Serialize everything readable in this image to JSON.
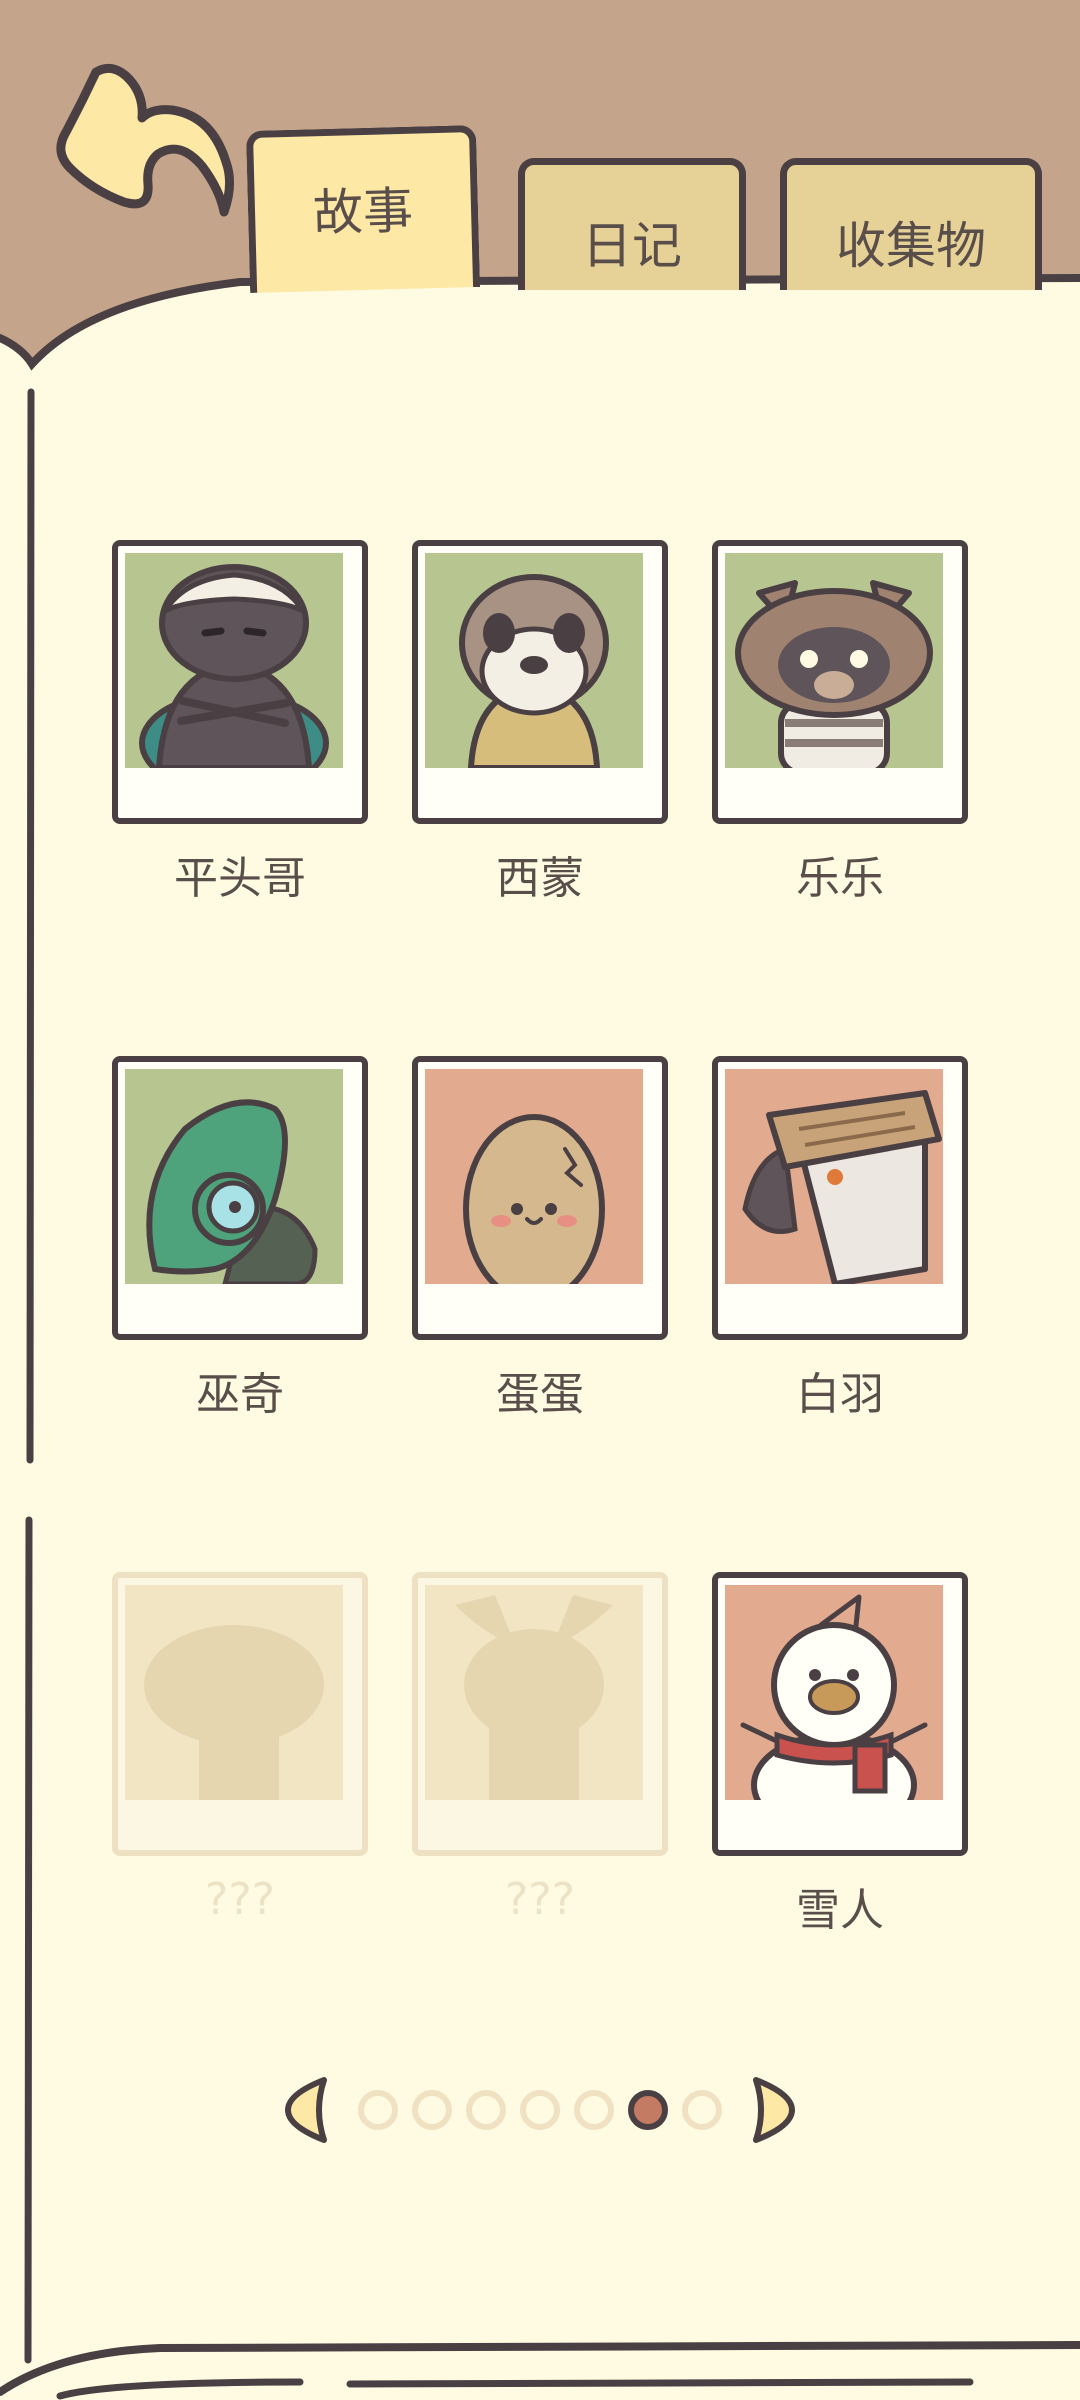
{
  "tabs": [
    {
      "label": "故事",
      "active": true
    },
    {
      "label": "日记",
      "active": false
    },
    {
      "label": "收集物",
      "active": false
    }
  ],
  "characters": [
    {
      "name": "平头哥",
      "icon": "honey-badger-icon",
      "bg": "#b7c590",
      "locked": false
    },
    {
      "name": "西蒙",
      "icon": "meerkat-icon",
      "bg": "#b7c590",
      "locked": false
    },
    {
      "name": "乐乐",
      "icon": "raccoon-icon",
      "bg": "#b7c590",
      "locked": false
    },
    {
      "name": "巫奇",
      "icon": "chameleon-icon",
      "bg": "#b7c590",
      "locked": false
    },
    {
      "name": "蛋蛋",
      "icon": "egg-icon",
      "bg": "#e2aa8e",
      "locked": false
    },
    {
      "name": "白羽",
      "icon": "bird-with-hat-icon",
      "bg": "#e2aa8e",
      "locked": false
    },
    {
      "name": "???",
      "icon": "locked-silhouette-icon",
      "bg": "#f1e5c4",
      "locked": true
    },
    {
      "name": "???",
      "icon": "locked-moose-silhouette-icon",
      "bg": "#f1e5c4",
      "locked": true
    },
    {
      "name": "雪人",
      "icon": "snowman-icon",
      "bg": "#e2aa8e",
      "locked": false
    }
  ],
  "pagination": {
    "total": 7,
    "current": 6
  },
  "colors": {
    "page": "#fffbe2",
    "header": "#c4a58c",
    "outline": "#4a4043",
    "active_dot": "#c47b64"
  }
}
